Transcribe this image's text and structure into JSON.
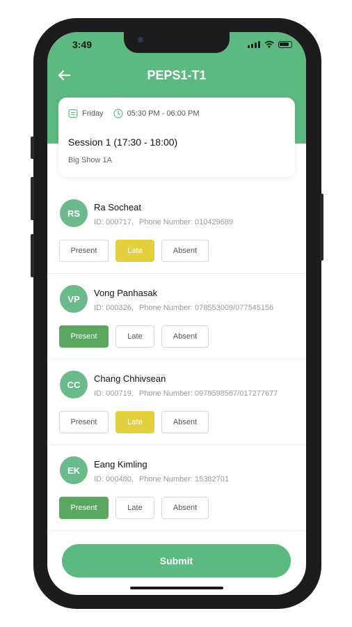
{
  "status_bar": {
    "time": "3:49"
  },
  "header": {
    "title": "PEPS1-T1"
  },
  "session": {
    "day": "Friday",
    "time_range": "05:30 PM - 06:00 PM",
    "title": "Session 1 (17:30 - 18:00)",
    "subtitle": "Big Show 1A"
  },
  "labels": {
    "id_prefix": "ID:",
    "phone_prefix": "Phone Number:",
    "present": "Present",
    "late": "Late",
    "absent": "Absent"
  },
  "students": [
    {
      "initials": "RS",
      "name": "Ra  Socheat",
      "id": "000717,",
      "phone": "010429689",
      "status": "late"
    },
    {
      "initials": "VP",
      "name": "Vong Panhasak",
      "id": "000326,",
      "phone": "078553009/077545156",
      "status": "present"
    },
    {
      "initials": "CC",
      "name": "Chang Chhivsean",
      "id": "000719,",
      "phone": "0979598567/017277677",
      "status": "late"
    },
    {
      "initials": "EK",
      "name": "Eang Kimling",
      "id": "000480,",
      "phone": "15382701",
      "status": "present"
    }
  ],
  "submit_label": "Submit",
  "colors": {
    "header_green": "#5cb97f",
    "present_green": "#5aa860",
    "late_yellow": "#e4cf3f",
    "avatar_green": "#6aba8c"
  },
  "icons": {
    "back": "arrow-left-icon",
    "calendar": "calendar-icon",
    "clock": "clock-icon"
  }
}
